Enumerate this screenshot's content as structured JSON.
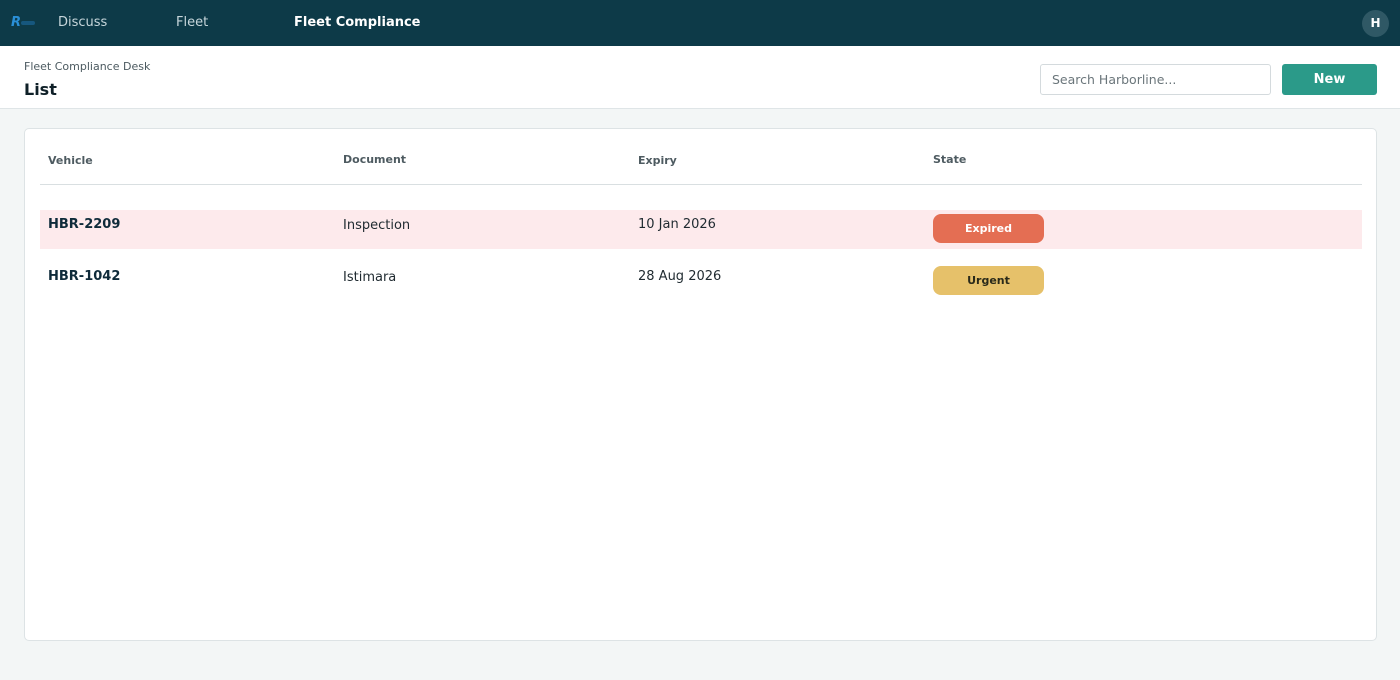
{
  "nav": {
    "items": [
      {
        "label": "Discuss"
      },
      {
        "label": "Fleet"
      },
      {
        "label": "Fleet Compliance"
      }
    ],
    "user_initial": "H"
  },
  "control_panel": {
    "breadcrumb_parent": "Fleet Compliance Desk",
    "title": "List",
    "search_placeholder": "Search Harborline...",
    "new_label": "New"
  },
  "table": {
    "columns": [
      "Vehicle",
      "Document",
      "Expiry",
      "State"
    ],
    "rows": [
      {
        "vehicle": "HBR-2209",
        "document": "Inspection",
        "expiry": "10 Jan 2026",
        "state": "Expired"
      },
      {
        "vehicle": "HBR-1042",
        "document": "Istimara",
        "expiry": "28 Aug 2026",
        "state": "Urgent"
      }
    ]
  },
  "colors": {
    "topbar": "#0d3a48",
    "primary": "#2b9a89",
    "expired_badge": "#e46e53",
    "urgent_badge": "#e6c16a",
    "expired_row": "#fdeaec"
  }
}
